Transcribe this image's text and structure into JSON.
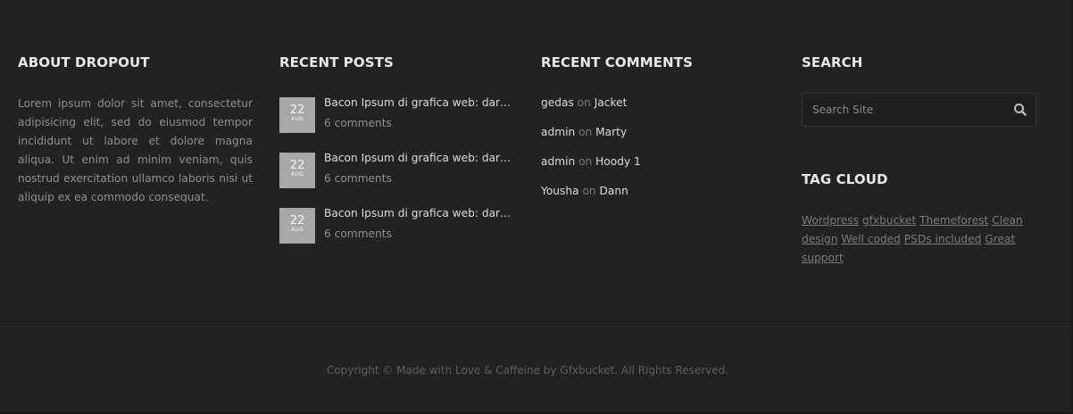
{
  "about": {
    "title": "ABOUT DROPOUT",
    "text": "Lorem ipsum dolor sit amet, consectetur adipisicing elit, sed do eiusmod tempor incididunt ut labore et dolore magna aliqua. Ut enim ad minim veniam, quis nostrud exercitation ullamco laboris nisi ut aliquip ex ea commodo consequat."
  },
  "recent_posts": {
    "title": "RECENT POSTS",
    "items": [
      {
        "day": "22",
        "month": "AUG",
        "title": "Bacon Ipsum di grafica web: dare...",
        "comments": "6 comments"
      },
      {
        "day": "22",
        "month": "AUG",
        "title": "Bacon Ipsum di grafica web: dare...",
        "comments": "6 comments"
      },
      {
        "day": "22",
        "month": "AUG",
        "title": "Bacon Ipsum di grafica web: dare...",
        "comments": "6 comments"
      }
    ]
  },
  "recent_comments": {
    "title": "RECENT COMMENTS",
    "items": [
      {
        "author": "gedas",
        "on": "on",
        "post": "Jacket"
      },
      {
        "author": "admin",
        "on": "on",
        "post": "Marty"
      },
      {
        "author": "admin",
        "on": "on",
        "post": "Hoody 1"
      },
      {
        "author": "Yousha",
        "on": "on",
        "post": "Dann"
      }
    ]
  },
  "search": {
    "title": "SEARCH",
    "placeholder": "Search Site",
    "icon": "search-icon"
  },
  "tag_cloud": {
    "title": "TAG CLOUD",
    "tags": [
      "Wordpress",
      "gfxbucket",
      "Themeforest",
      "Clean design",
      "Well coded",
      "PSDs included",
      "Great support"
    ]
  },
  "footer": {
    "copyright": "Copyright © Made with Love & Caffeine by Gfxbucket. All Rights Reserved."
  },
  "colors": {
    "background": "#222222",
    "heading": "#e8e8e8",
    "muted": "#8f8f8f",
    "date_badge": "#a8a8a8"
  }
}
